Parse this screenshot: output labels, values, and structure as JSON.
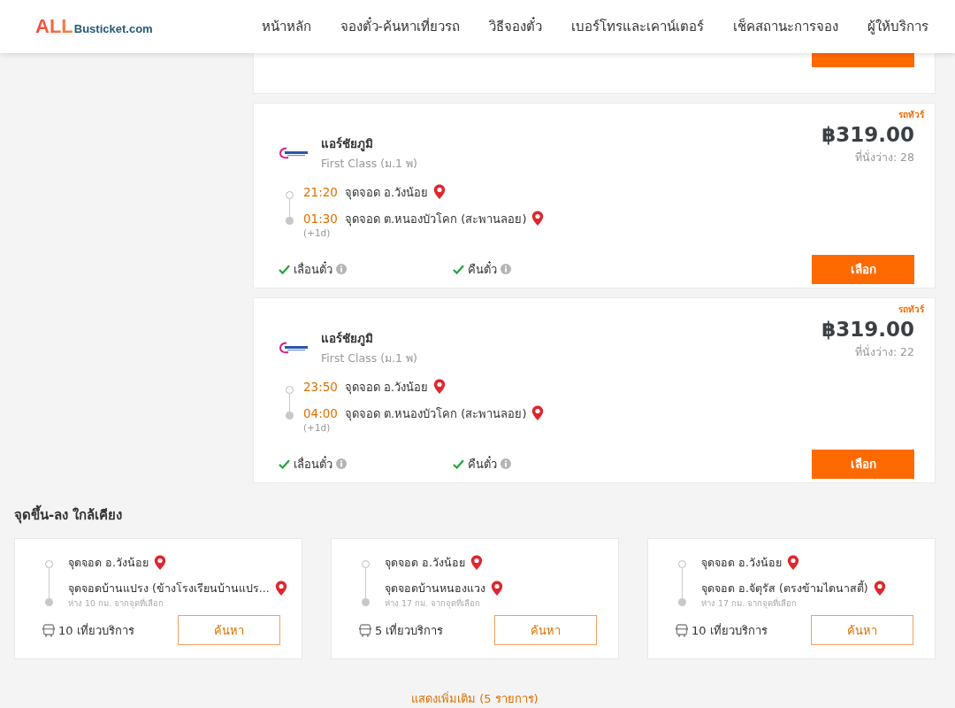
{
  "header": {
    "logo": {
      "main": "ALL",
      "sub": "Busticket.com"
    },
    "nav": [
      {
        "label": "หน้าหลัก"
      },
      {
        "label": "จองตั๋ว-ค้นหาเที่ยวรถ"
      },
      {
        "label": "วิธีจองตั๋ว"
      },
      {
        "label": "เบอร์โทรและเคาน์เตอร์"
      },
      {
        "label": "เช็คสถานะการจอง"
      },
      {
        "label": "ผู้ให้บริการ"
      }
    ]
  },
  "trips": [
    {
      "tag": "รถทัวร์",
      "operator": "แอร์ชัยภูมิ",
      "class": "First Class (ม.1 พ)",
      "price": "฿319.00",
      "seats": "ที่นั่งว่าง: 28",
      "depart_time": "21:20",
      "depart_stop": "จุดจอด อ.วังน้อย",
      "arrive_time": "01:30",
      "arrive_stop": "จุดจอด ต.หนองบัวโคก (สะพานลอย)",
      "day_offset": "(+1d)",
      "features": [
        {
          "label": "เลื่อนตั๋ว",
          "available": true
        },
        {
          "label": "คืนตั๋ว",
          "available": true
        }
      ],
      "button": "เลือก"
    },
    {
      "tag": "รถทัวร์",
      "operator": "แอร์ชัยภูมิ",
      "class": "First Class (ม.1 พ)",
      "price": "฿319.00",
      "seats": "ที่นั่งว่าง: 22",
      "depart_time": "23:50",
      "depart_stop": "จุดจอด อ.วังน้อย",
      "arrive_time": "04:00",
      "arrive_stop": "จุดจอด ต.หนองบัวโคก (สะพานลอย)",
      "day_offset": "(+1d)",
      "features": [
        {
          "label": "เลื่อนตั๋ว",
          "available": true
        },
        {
          "label": "คืนตั๋ว",
          "available": true
        }
      ],
      "button": "เลือก"
    }
  ],
  "nearby": {
    "title": "จุดขึ้น-ลง ใกล้เคียง",
    "cards": [
      {
        "from": "จุดจอด อ.วังน้อย",
        "to": "จุดจอดบ้านแปรง (ข้างโรงเรียนบ้านแปร...",
        "distance": "ห่าง 10 กม. จากจุดที่เลือก",
        "trips": "10 เที่ยวบริการ",
        "button": "ค้นหา"
      },
      {
        "from": "จุดจอด อ.วังน้อย",
        "to": "จุดจอดบ้านหนองแวง",
        "distance": "ห่าง 17 กม. จากจุดที่เลือก",
        "trips": "5 เที่ยวบริการ",
        "button": "ค้นหา"
      },
      {
        "from": "จุดจอด อ.วังน้อย",
        "to": "จุดจอด อ.จัตุรัส (ตรงข้ามไดนาสตี้)",
        "distance": "ห่าง 17 กม. จากจุดที่เลือก",
        "trips": "10 เที่ยวบริการ",
        "button": "ค้นหา"
      }
    ],
    "more": "แสดงเพิ่มเติม (5 รายการ)"
  }
}
